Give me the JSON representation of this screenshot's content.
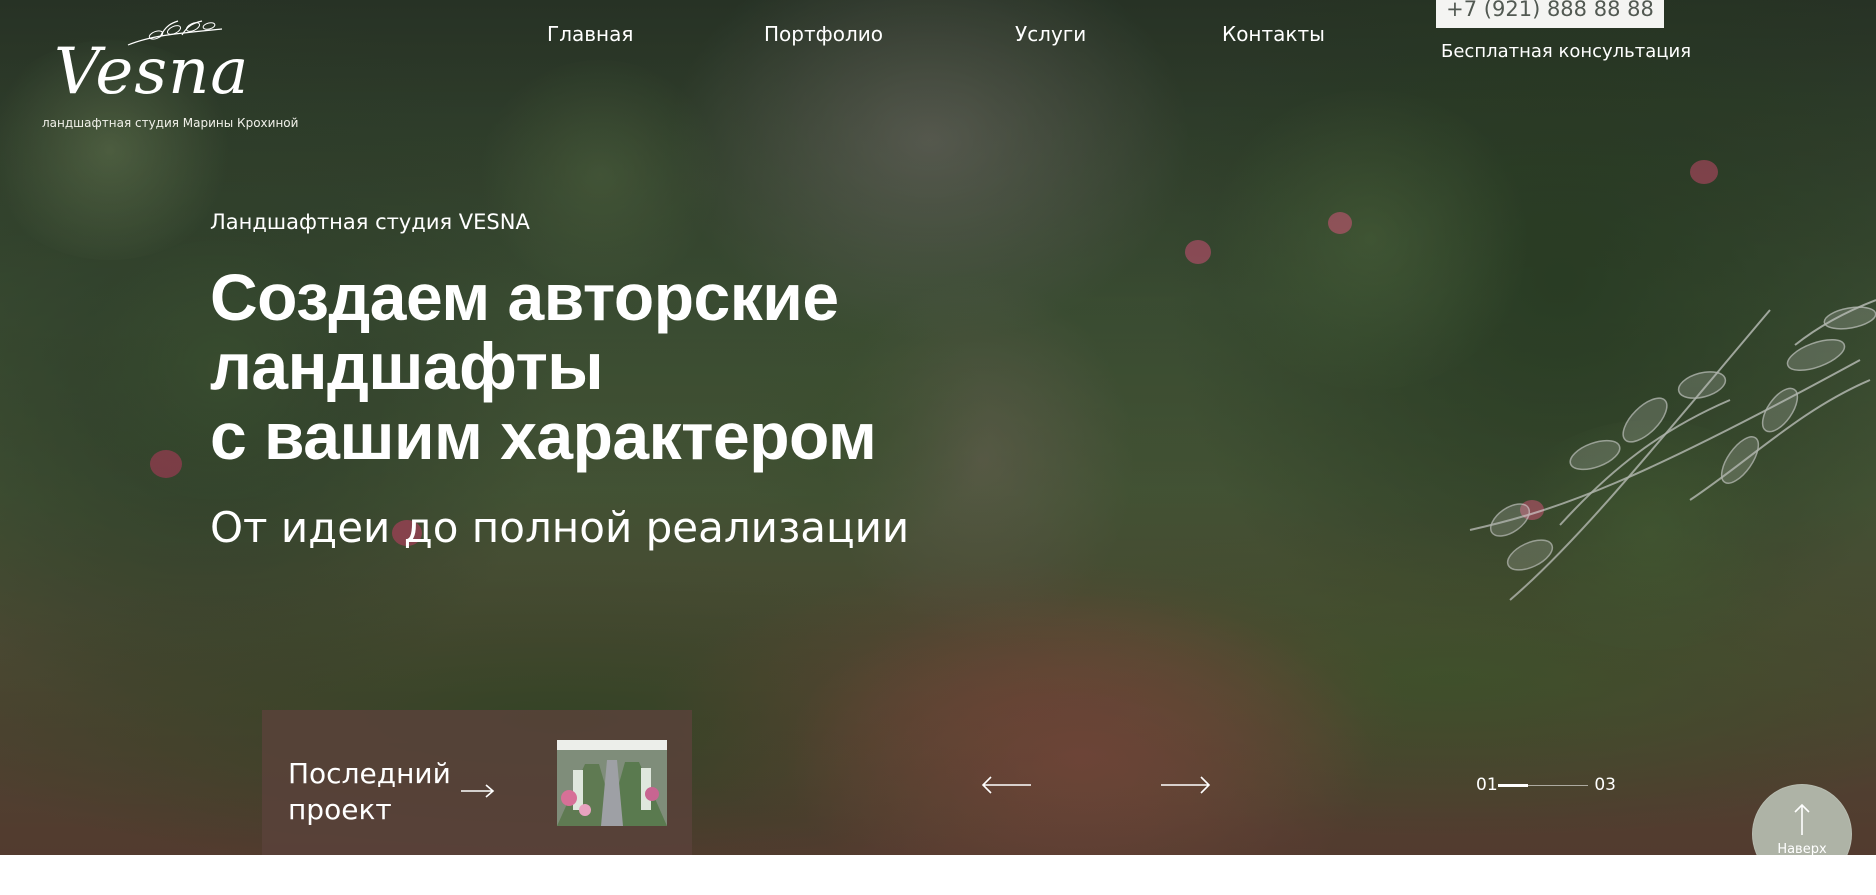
{
  "brand": {
    "name": "Vesna",
    "subtitle": "ландшафтная студия Марины Крохиной"
  },
  "nav": {
    "items": [
      {
        "label": "Главная"
      },
      {
        "label": "Портфолио"
      },
      {
        "label": "Услуги"
      },
      {
        "label": "Контакты"
      }
    ],
    "phone": "+7 (921) 888 88 88",
    "consultation": "Бесплатная консультация"
  },
  "hero": {
    "eyebrow": "Ландшафтная студия VESNA",
    "title": "Создаем авторские ландшафты\nс вашим характером",
    "subtitle": "От идеи до полной реализации"
  },
  "project": {
    "label": "Последний\nпроект"
  },
  "slider": {
    "current": "01",
    "total": "03",
    "progress": 0.333
  },
  "controls": {
    "top_label": "Наверх"
  },
  "icons": {
    "logo_decoration": "sprig-icon",
    "project_arrow": "arrow-right-icon",
    "prev_arrow": "arrow-left-icon",
    "next_arrow": "arrow-right-icon",
    "top_arrow": "arrow-up-icon",
    "leaf_art": "leaf-illustration-icon"
  },
  "colors": {
    "hero_text": "#ffffff",
    "phone_bg": "#f4f4f2",
    "phone_text": "#525952",
    "project_bg": "#5a423a",
    "top_button_bg": "#aeb3a6"
  }
}
